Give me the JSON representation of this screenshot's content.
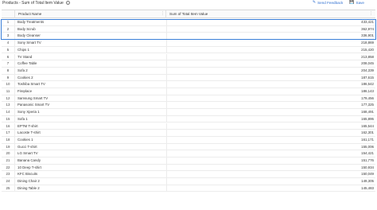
{
  "header": {
    "title": "Products - Sum of Total Item Value",
    "info_icon": "info-circle-icon",
    "send_feedback_label": "Send Feedback",
    "save_label": "Save"
  },
  "table": {
    "columns": [
      "Product Name",
      "Sum of Total Item Value"
    ],
    "rows": [
      {
        "num": "1",
        "name": "Body Treatments",
        "value": "433,421"
      },
      {
        "num": "2",
        "name": "Body Scrub",
        "value": "362,974"
      },
      {
        "num": "3",
        "name": "Body Cleanser",
        "value": "336,901"
      },
      {
        "num": "4",
        "name": "Sony Smart TV",
        "value": "218,869"
      },
      {
        "num": "5",
        "name": "Chips 1",
        "value": "215,420"
      },
      {
        "num": "6",
        "name": "TV Stand",
        "value": "213,858"
      },
      {
        "num": "7",
        "name": "Coffee Table",
        "value": "208,045"
      },
      {
        "num": "8",
        "name": "Sofa 2",
        "value": "204,339"
      },
      {
        "num": "9",
        "name": "Cookies 2",
        "value": "187,615"
      },
      {
        "num": "10",
        "name": "Toshiba Smart TV",
        "value": "186,542"
      },
      {
        "num": "11",
        "name": "Fireplace",
        "value": "186,143"
      },
      {
        "num": "12",
        "name": "Samsung Smart TV",
        "value": "179,456"
      },
      {
        "num": "13",
        "name": "Panasonic Smart TV",
        "value": "177,325"
      },
      {
        "num": "14",
        "name": "Sony Xperia 1",
        "value": "168,491"
      },
      {
        "num": "15",
        "name": "Sofa 1",
        "value": "165,895"
      },
      {
        "num": "16",
        "name": "EPTM T-shirt",
        "value": "165,544"
      },
      {
        "num": "17",
        "name": "Lacoste T-shirt",
        "value": "162,301"
      },
      {
        "num": "18",
        "name": "Cookies 1",
        "value": "161,171"
      },
      {
        "num": "19",
        "name": "Gucci T-shirt",
        "value": "155,006"
      },
      {
        "num": "20",
        "name": "LG Smart TV",
        "value": "154,421"
      },
      {
        "num": "21",
        "name": "Banana Candy",
        "value": "151,776"
      },
      {
        "num": "22",
        "name": "10 Deep T-shirt",
        "value": "150,934"
      },
      {
        "num": "23",
        "name": "KFC Biscuits",
        "value": "150,049"
      },
      {
        "num": "24",
        "name": "Dining Chair 2",
        "value": "149,305"
      },
      {
        "num": "25",
        "name": "Dining Table 2",
        "value": "145,483"
      }
    ],
    "selected_rows": [
      "1",
      "2",
      "3"
    ]
  },
  "colors": {
    "accent": "#2f6fd0",
    "selection_border": "#3a7fd8"
  }
}
